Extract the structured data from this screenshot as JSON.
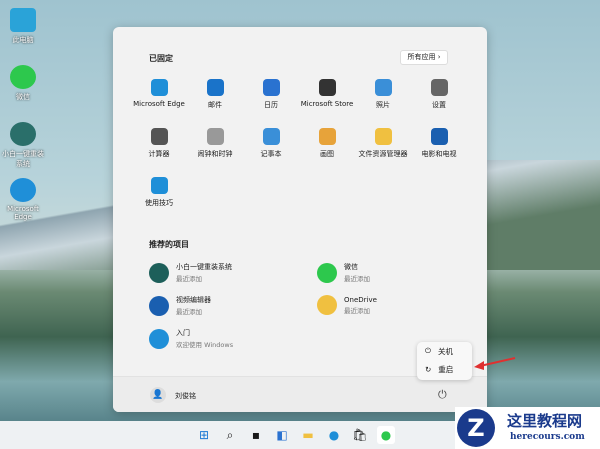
{
  "desktop": {
    "icons": [
      {
        "label": "此电脑"
      },
      {
        "label": "微信"
      },
      {
        "label": "小白一键重装系统"
      },
      {
        "label": "Microsoft Edge"
      }
    ]
  },
  "start": {
    "pinned_title": "已固定",
    "all_apps": "所有应用 ›",
    "pinned": [
      {
        "label": "Microsoft Edge",
        "color": "#1f8fd8"
      },
      {
        "label": "邮件",
        "color": "#1a73c9"
      },
      {
        "label": "日历",
        "color": "#2a72d0"
      },
      {
        "label": "Microsoft Store",
        "color": "#333333"
      },
      {
        "label": "照片",
        "color": "#3a8fd8"
      },
      {
        "label": "设置",
        "color": "#666666"
      },
      {
        "label": "计算器",
        "color": "#555555"
      },
      {
        "label": "闹钟和时钟",
        "color": "#999999"
      },
      {
        "label": "记事本",
        "color": "#3a8fd8"
      },
      {
        "label": "画图",
        "color": "#e7a33a"
      },
      {
        "label": "文件资源管理器",
        "color": "#f0c040"
      },
      {
        "label": "电影和电视",
        "color": "#1a5fb0"
      },
      {
        "label": "使用技巧",
        "color": "#1f8fd8"
      }
    ],
    "recommended_title": "推荐的项目",
    "recommended": [
      {
        "title": "小白一键重装系统",
        "sub": "最近添加"
      },
      {
        "title": "微信",
        "sub": "最近添加"
      },
      {
        "title": "视频编辑器",
        "sub": "最近添加"
      },
      {
        "title": "OneDrive",
        "sub": "最近添加"
      },
      {
        "title": "入门",
        "sub": "欢迎使用 Windows"
      }
    ],
    "user": "刘俊铭"
  },
  "power_menu": {
    "shutdown": "关机",
    "restart": "重启"
  },
  "watermark": {
    "title": "这里教程网",
    "url": "herecours.com"
  }
}
